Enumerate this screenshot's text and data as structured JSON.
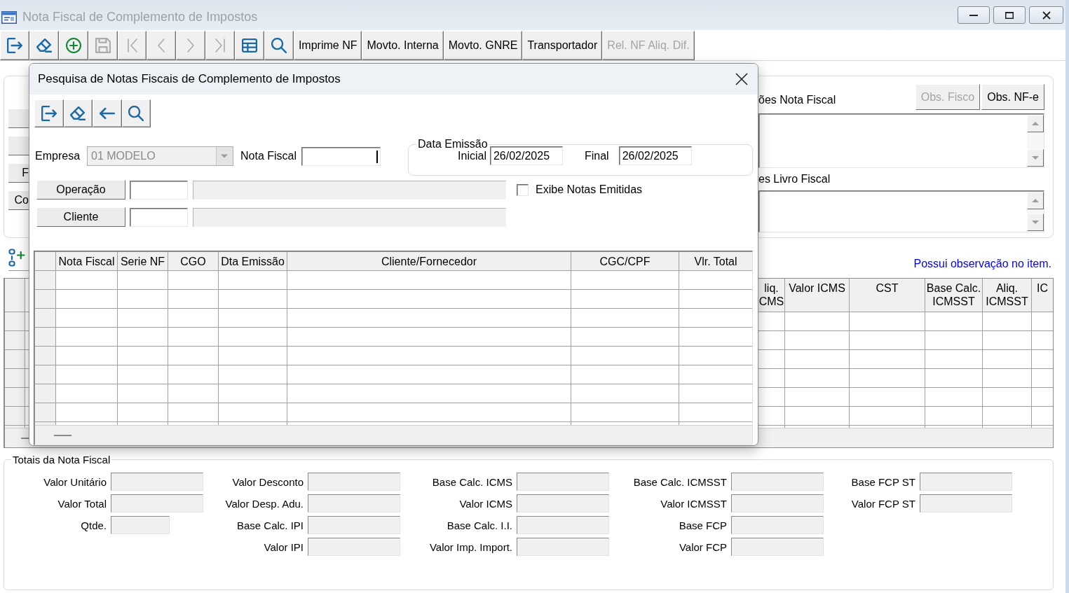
{
  "window": {
    "title": "Nota Fiscal de Complemento de Impostos",
    "active": false
  },
  "toolbar": {
    "icon_buttons": [
      {
        "disabled": false
      },
      {
        "disabled": false
      },
      {
        "disabled": false
      },
      {
        "disabled": true
      },
      {
        "disabled": true
      },
      {
        "disabled": true
      },
      {
        "disabled": true
      },
      {
        "disabled": true
      },
      {
        "disabled": false
      },
      {
        "disabled": false
      }
    ],
    "text_buttons": [
      {
        "label": "Imprime NF",
        "disabled": false
      },
      {
        "label": "Movto. Interna",
        "disabled": false
      },
      {
        "label": "Movto. GNRE",
        "disabled": false
      },
      {
        "label": "Transportador",
        "disabled": false
      },
      {
        "label": "Rel. NF Aliq. Dif.",
        "disabled": true
      }
    ]
  },
  "side_buttons": [
    "F",
    "Co"
  ],
  "observations": {
    "nota_fiscal_label": "ões Nota Fiscal",
    "buttons": [
      {
        "label": "Obs. Fisco",
        "disabled": true
      },
      {
        "label": "Obs. NF-e",
        "disabled": false
      }
    ],
    "livro_fiscal_label": "es Livro Fiscal"
  },
  "item_note": "Possui observação no item.",
  "items_grid": {
    "columns": [
      "liq. CMS",
      "Valor ICMS",
      "CST",
      "Base Calc. ICMSST",
      "Aliq. ICMSST",
      "IC"
    ]
  },
  "totals": {
    "title": "Totais da Nota Fiscal",
    "columns": [
      {
        "fields": [
          {
            "label": "Valor Unitário",
            "disabled": true
          },
          {
            "label": "Valor Total",
            "disabled": true
          },
          {
            "label": "Qtde.",
            "disabled": true
          }
        ]
      },
      {
        "fields": [
          {
            "label": "Valor Desconto",
            "disabled": true
          },
          {
            "label": "Valor Desp. Adu.",
            "disabled": true
          },
          {
            "label": "Base Calc. IPI",
            "disabled": true
          },
          {
            "label": "Valor IPI",
            "disabled": true
          }
        ]
      },
      {
        "fields": [
          {
            "label": "Base Calc. ICMS",
            "disabled": true
          },
          {
            "label": "Valor ICMS",
            "disabled": true
          },
          {
            "label": "Base Calc. I.I.",
            "disabled": true
          },
          {
            "label": "Valor Imp. Import.",
            "disabled": true
          }
        ]
      },
      {
        "fields": [
          {
            "label": "Base Calc. ICMSST",
            "disabled": true
          },
          {
            "label": "Valor ICMSST",
            "disabled": true
          },
          {
            "label": "Base FCP",
            "disabled": true
          },
          {
            "label": "Valor FCP",
            "disabled": true
          }
        ]
      },
      {
        "fields": [
          {
            "label": "Base FCP ST",
            "disabled": true
          },
          {
            "label": "Valor FCP ST",
            "disabled": true
          }
        ]
      }
    ]
  },
  "dialog": {
    "title": "Pesquisa de Notas Fiscais de Complemento de Impostos",
    "toolbar": [
      {
        "disabled": false
      },
      {
        "disabled": false
      },
      {
        "disabled": false
      },
      {
        "disabled": false
      }
    ],
    "empresa": {
      "label": "Empresa",
      "value": "01 MODELO",
      "disabled": true
    },
    "nota_fiscal": {
      "label": "Nota Fiscal",
      "focused": true
    },
    "data_emissao": {
      "title": "Data Emissão",
      "inicial": {
        "label": "Inicial",
        "value": "26/02/2025"
      },
      "final": {
        "label": "Final",
        "value": "26/02/2025"
      }
    },
    "lookups": [
      {
        "button": "Operação",
        "description_disabled": true
      },
      {
        "button": "Cliente",
        "description_disabled": true
      }
    ],
    "exibe_notas_emitidas": {
      "label": "Exibe Notas Emitidas",
      "checked": false
    },
    "grid": {
      "columns": [
        "Nota Fiscal",
        "Serie NF",
        "CGO",
        "Dta Emissão",
        "Cliente/Fornecedor",
        "CGC/CPF",
        "Vlr. Total"
      ]
    }
  }
}
